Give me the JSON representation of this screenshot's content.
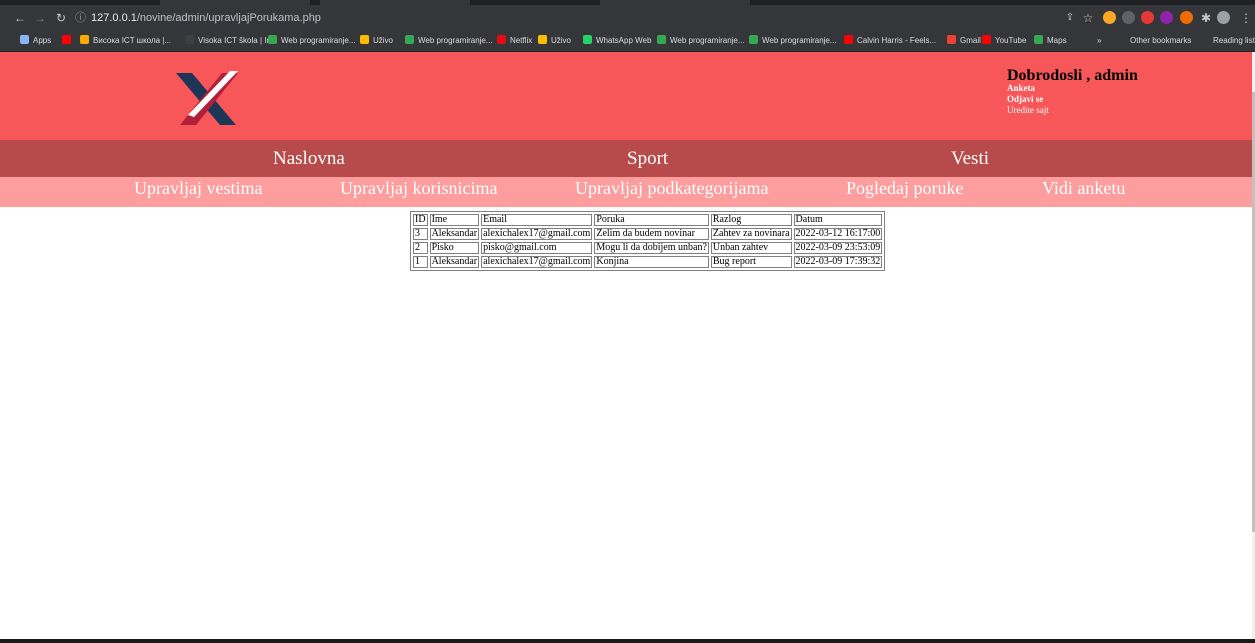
{
  "browser": {
    "url_host": "127.0.0.1",
    "url_path": "/novine/admin/upravljajPorukama.php",
    "bookmarks": [
      {
        "label": "Apps",
        "color": "#8ab4f8"
      },
      {
        "label": "",
        "color": "#ff0000"
      },
      {
        "label": "Висока ICT школа |...",
        "color": "#f9ab00"
      },
      {
        "label": "Visoka ICT škola | In...",
        "color": "#3c4043"
      },
      {
        "label": "Web programiranje...",
        "color": "#34a853"
      },
      {
        "label": "Uživo",
        "color": "#fbbc04"
      },
      {
        "label": "Web programiranje...",
        "color": "#34a853"
      },
      {
        "label": "Netflix",
        "color": "#e50914"
      },
      {
        "label": "Uživo",
        "color": "#fbbc04"
      },
      {
        "label": "WhatsApp Web",
        "color": "#25d366"
      },
      {
        "label": "Web programiranje...",
        "color": "#34a853"
      },
      {
        "label": "Web programiranje...",
        "color": "#34a853"
      },
      {
        "label": "Calvin Harris - Feels...",
        "color": "#ff0000"
      },
      {
        "label": "Gmail",
        "color": "#ea4335"
      },
      {
        "label": "YouTube",
        "color": "#ff0000"
      },
      {
        "label": "Maps",
        "color": "#34a853"
      }
    ],
    "more_bookmarks": "»",
    "other_bookmarks": "Other bookmarks",
    "reading_list": "Reading list"
  },
  "header": {
    "greeting": "Dobrodosli , admin",
    "links": [
      "Anketa",
      "Odjavi se",
      "Uredite sajt"
    ]
  },
  "nav": {
    "main": [
      "Naslovna",
      "Sport",
      "Vesti"
    ],
    "admin": [
      "Upravljaj vestima",
      "Upravljaj korisnicima",
      "Upravljaj podkategorijama",
      "Pogledaj poruke",
      "Vidi anketu"
    ]
  },
  "messages": {
    "columns": [
      "ID",
      "Ime",
      "Email",
      "Poruka",
      "Razlog",
      "Datum"
    ],
    "rows": [
      [
        "3",
        "Aleksandar",
        "alexichalex17@gmail.com",
        "Zelim da budem novinar",
        "Zahtev za novinara",
        "2022-03-12 16:17:00"
      ],
      [
        "2",
        "Pisko",
        "pisko@gmail.com",
        "Mogu li da dobijem unban?",
        "Unban zahtev",
        "2022-03-09 23:53:09"
      ],
      [
        "1",
        "Aleksandar",
        "alexichalex17@gmail.com",
        "Konjina",
        "Bug report",
        "2022-03-09 17:39:32"
      ]
    ]
  },
  "colors": {
    "header_bg": "#f85759",
    "main_nav_bg": "#b74b4b",
    "admin_nav_bg": "#fe9d9d"
  }
}
